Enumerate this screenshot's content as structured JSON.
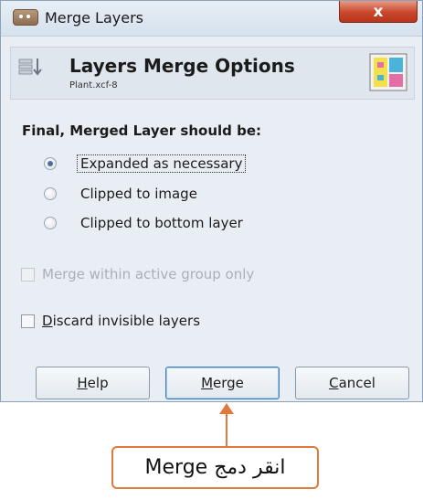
{
  "window": {
    "title": "Merge Layers",
    "close_label": "x"
  },
  "header": {
    "title": "Layers Merge Options",
    "subtitle": "Plant.xcf-8"
  },
  "options": {
    "section_label": "Final, Merged Layer should be:",
    "radios": [
      {
        "label": "Expanded as necessary",
        "selected": true
      },
      {
        "label": "Clipped to image",
        "selected": false
      },
      {
        "label": "Clipped to bottom layer",
        "selected": false
      }
    ],
    "merge_active_group": {
      "label": "Merge within active group only",
      "checked": false,
      "enabled": false
    },
    "discard_invisible": {
      "label_first": "D",
      "label_rest": "iscard invisible layers",
      "checked": false,
      "enabled": true
    }
  },
  "buttons": {
    "help": {
      "mnemonic": "H",
      "rest": "elp"
    },
    "merge": {
      "mnemonic": "M",
      "rest": "erge"
    },
    "cancel": {
      "mnemonic": "C",
      "rest": "ancel"
    }
  },
  "callout": {
    "text": "انقر دمج Merge"
  },
  "colors": {
    "accent": "#e07a3c",
    "close": "#c9472b"
  }
}
